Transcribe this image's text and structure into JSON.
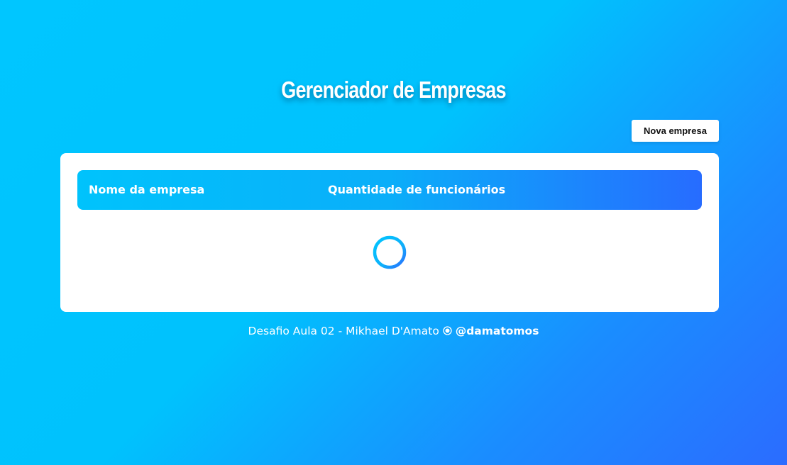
{
  "header": {
    "title": "Gerenciador de Empresas"
  },
  "toolbar": {
    "new_company_label": "Nova empresa"
  },
  "table": {
    "columns": [
      "Nome da empresa",
      "Quantidade de funcionários"
    ],
    "loading": true
  },
  "footer": {
    "text": "Desafio Aula 02 - Mikhael D'Amato",
    "icon": "instagram-icon",
    "handle": "@damatomos"
  },
  "colors": {
    "background_start": "#00c6ff",
    "background_end": "#2b6cff",
    "header_start": "#00c3fc",
    "header_end": "#276cff",
    "card": "#ffffff"
  }
}
